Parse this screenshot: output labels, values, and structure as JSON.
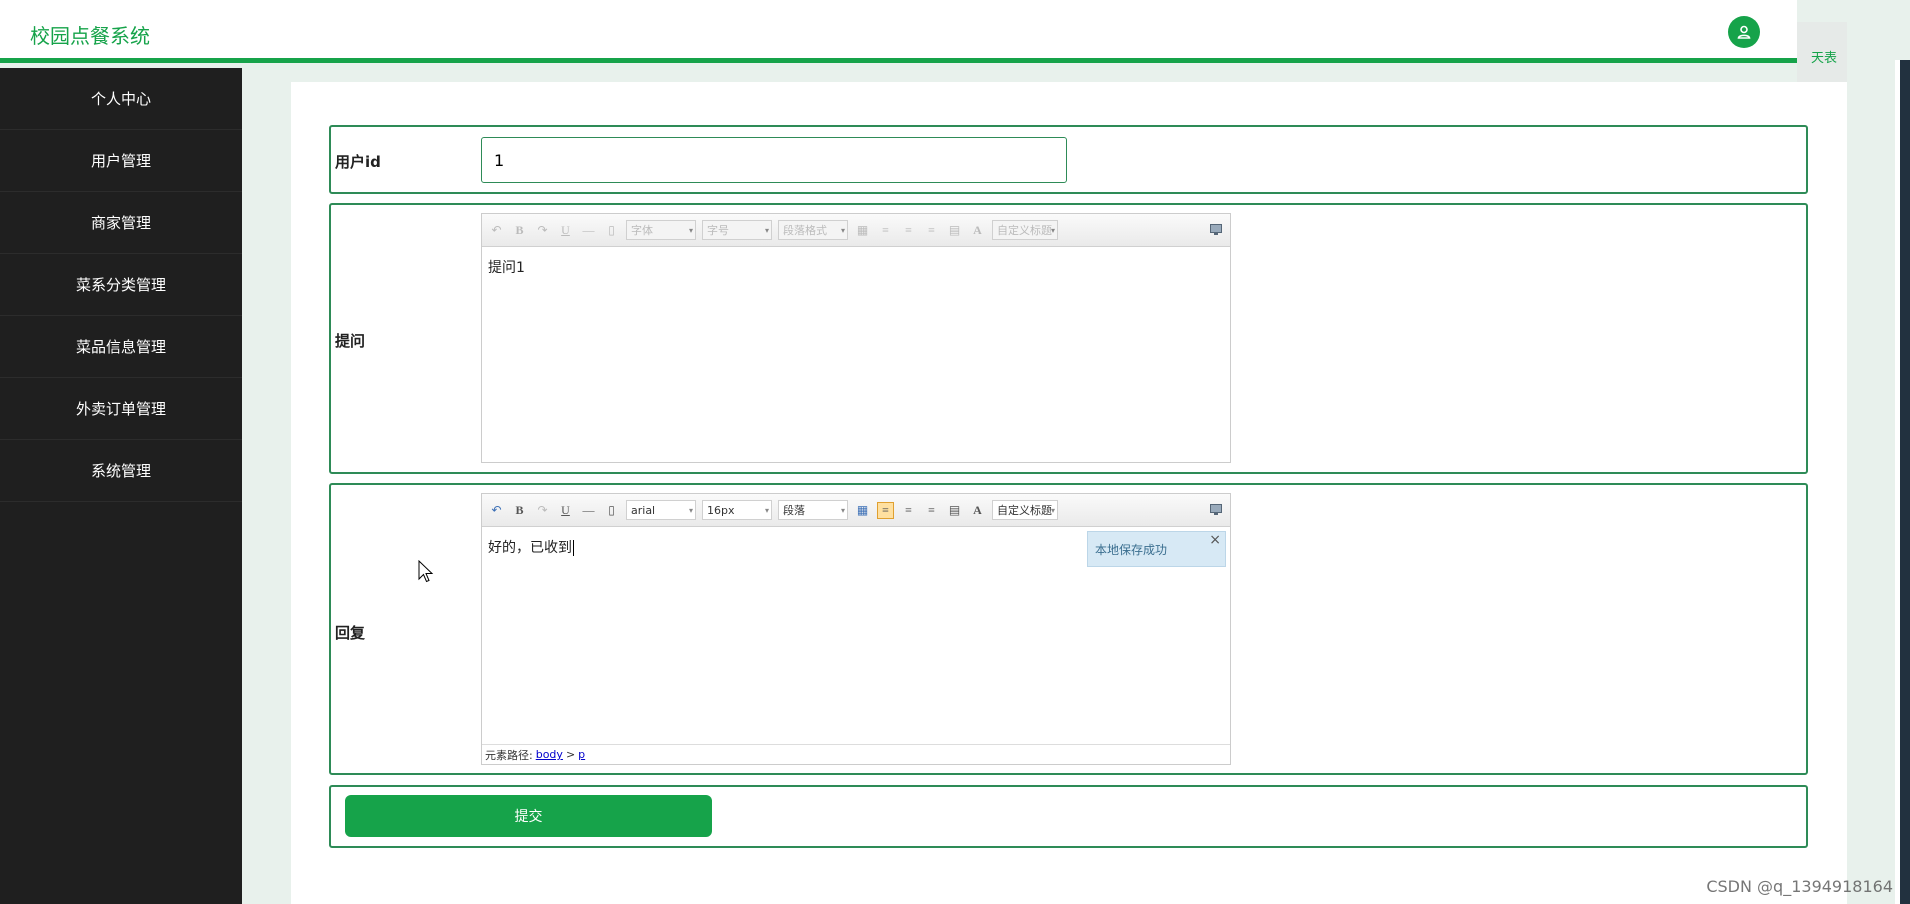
{
  "header": {
    "brand": "校园点餐系统",
    "avatar_icon": "user-icon",
    "right_tab": "天表"
  },
  "sidebar": {
    "items": [
      {
        "label": "个人中心"
      },
      {
        "label": "用户管理"
      },
      {
        "label": "商家管理"
      },
      {
        "label": "菜系分类管理"
      },
      {
        "label": "菜品信息管理"
      },
      {
        "label": "外卖订单管理"
      },
      {
        "label": "系统管理"
      }
    ]
  },
  "form": {
    "userid": {
      "label": "用户id",
      "value": "1"
    },
    "question": {
      "label": "提问",
      "content": "提问1",
      "toolbar": {
        "font": "字体",
        "size": "字号",
        "paragraph": "段落格式",
        "custom": "自定义标题"
      }
    },
    "reply": {
      "label": "回复",
      "content": "好的，已收到",
      "toolbar": {
        "font": "arial",
        "size": "16px",
        "paragraph": "段落",
        "custom": "自定义标题"
      },
      "toast": "本地保存成功",
      "path_prefix": "元素路径:",
      "path_body": "body",
      "path_sep": ">",
      "path_p": "p"
    },
    "submit_label": "提交"
  },
  "watermark": "CSDN @q_1394918164",
  "colors": {
    "accent": "#16a34a",
    "sidebar": "#1f1f1f",
    "border": "#2e8b57"
  }
}
